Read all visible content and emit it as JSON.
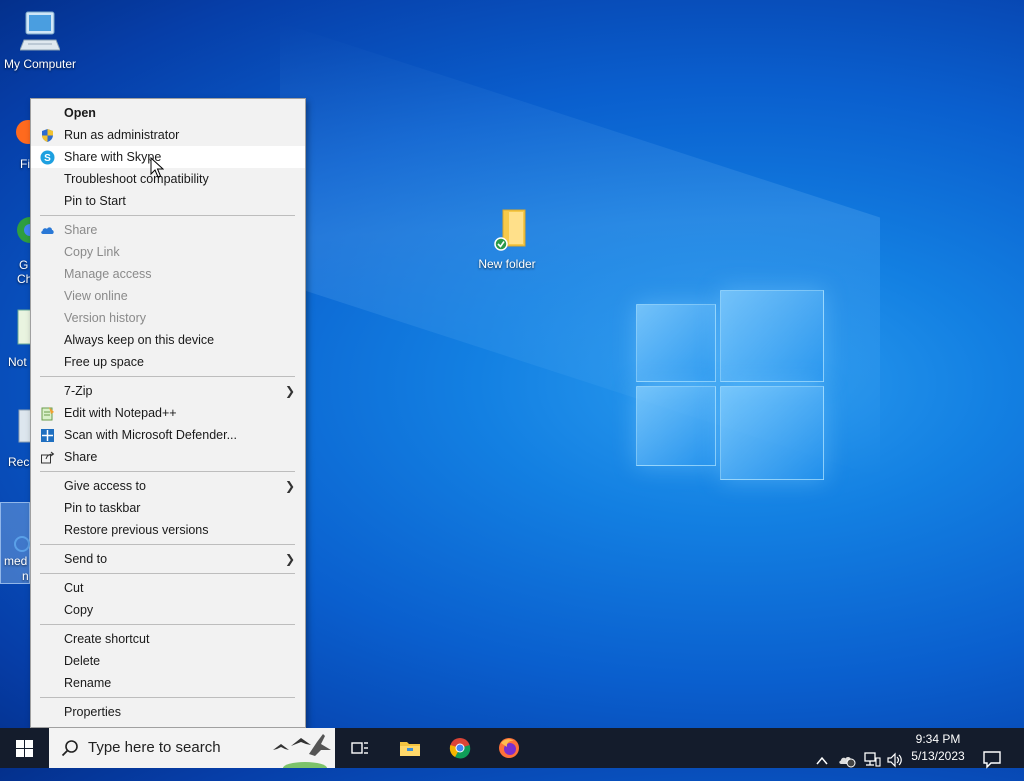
{
  "desktop": {
    "icons": {
      "my_computer": "My Computer",
      "new_folder": "New folder"
    },
    "partial_labels": {
      "firefox": "Fi",
      "chrome_1": "G",
      "chrome_2": "Ch",
      "notepad": "Not",
      "recycle": "Rec",
      "media_1": "med",
      "media_2": "n"
    }
  },
  "context_menu": {
    "items": [
      {
        "label": "Open",
        "bold": true
      },
      {
        "label": "Run as administrator",
        "icon": "shield-icon"
      },
      {
        "label": "Share with Skype",
        "icon": "skype-icon",
        "highlighted": true
      },
      {
        "label": "Troubleshoot compatibility"
      },
      {
        "label": "Pin to Start"
      },
      {
        "label": "Share",
        "icon": "onedrive-cloud-icon",
        "disabled": true
      },
      {
        "label": "Copy Link",
        "disabled": true
      },
      {
        "label": "Manage access",
        "disabled": true
      },
      {
        "label": "View online",
        "disabled": true
      },
      {
        "label": "Version history",
        "disabled": true
      },
      {
        "label": "Always keep on this device"
      },
      {
        "label": "Free up space"
      },
      {
        "label": "7-Zip",
        "submenu": true
      },
      {
        "label": "Edit with Notepad++",
        "icon": "notepad-plus-icon"
      },
      {
        "label": "Scan with Microsoft Defender...",
        "icon": "defender-icon"
      },
      {
        "label": "Share",
        "icon": "share-icon"
      },
      {
        "label": "Give access to",
        "submenu": true
      },
      {
        "label": "Pin to taskbar"
      },
      {
        "label": "Restore previous versions"
      },
      {
        "label": "Send to",
        "submenu": true
      },
      {
        "label": "Cut"
      },
      {
        "label": "Copy"
      },
      {
        "label": "Create shortcut"
      },
      {
        "label": "Delete"
      },
      {
        "label": "Rename"
      },
      {
        "label": "Properties"
      }
    ]
  },
  "taskbar": {
    "search_placeholder": "Type here to search",
    "clock_time": "9:34 PM",
    "clock_date": "5/13/2023"
  },
  "colors": {
    "menu_bg": "#f2f2f2",
    "menu_highlight": "#ffffff",
    "taskbar_bg": "#141c2c",
    "desktop_blue": "#0a5fce"
  }
}
